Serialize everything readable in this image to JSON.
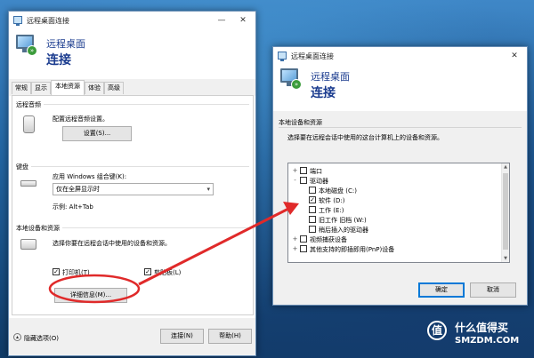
{
  "colors": {
    "accent_blue": "#1b3c8f",
    "annotation_red": "#e02a2a",
    "focus_blue": "#0078d7",
    "desktop_blue": "#22639f"
  },
  "left_window": {
    "title": "远程桌面连接",
    "minimize_glyph": "—",
    "close_glyph": "✕",
    "header_line1": "远程桌面",
    "header_line2": "连接",
    "tabs": [
      "常规",
      "显示",
      "本地资源",
      "体验",
      "高级"
    ],
    "active_tab": "本地资源",
    "remote_audio": {
      "group_label": "远程音频",
      "description": "配置远程音频设置。",
      "settings_button": "设置(S)..."
    },
    "keyboard": {
      "group_label": "键盘",
      "description": "应用 Windows 组合键(K):",
      "selected_option": "仅在全屏显示时",
      "example": "示例: Alt+Tab"
    },
    "local_devices": {
      "group_label": "本地设备和资源",
      "description": "选择你要在远程会话中使用的设备和资源。",
      "printer_label": "打印机(T)",
      "printer_checked": true,
      "clipboard_label": "剪贴板(L)",
      "clipboard_checked": true,
      "more_button": "详细信息(M)..."
    },
    "footer": {
      "hide_options": "隐藏选项(O)",
      "connect_button": "连接(N)",
      "help_button": "帮助(H)"
    }
  },
  "right_window": {
    "title": "远程桌面连接",
    "close_glyph": "✕",
    "header_line1": "远程桌面",
    "header_line2": "连接",
    "group_label": "本地设备和资源",
    "description": "选择要在远程会话中使用的这台计算机上的设备和资源。",
    "tree": [
      {
        "label": "端口",
        "checked": false,
        "expander": "+"
      },
      {
        "label": "驱动器",
        "checked": false,
        "expander": "-"
      },
      {
        "label": "本地磁盘 (C:)",
        "checked": false,
        "expander": ""
      },
      {
        "label": "软件 (D:)",
        "checked": true,
        "expander": ""
      },
      {
        "label": "工作 (E:)",
        "checked": false,
        "expander": ""
      },
      {
        "label": "旧工作 旧档 (W:)",
        "checked": false,
        "expander": ""
      },
      {
        "label": "稍后插入的驱动器",
        "checked": false,
        "expander": ""
      },
      {
        "label": "视频捕获设备",
        "checked": false,
        "expander": "+"
      },
      {
        "label": "其他支持的即插即用(PnP)设备",
        "checked": false,
        "expander": "+"
      }
    ],
    "ok_button": "确定",
    "cancel_button": "取消"
  },
  "watermark": {
    "logo_glyph": "值",
    "line1": "什么值得买",
    "line2": "SMZDM.COM"
  }
}
